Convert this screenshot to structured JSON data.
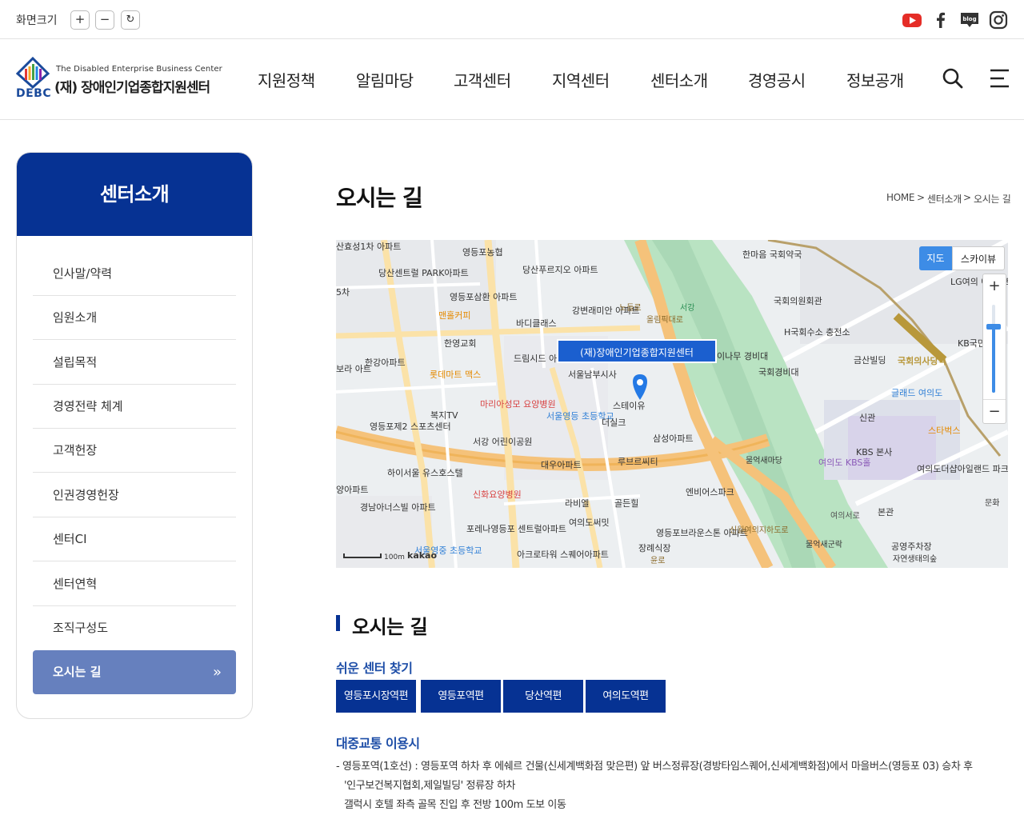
{
  "util": {
    "zoom_label": "화면크기",
    "zoom_in": "+",
    "zoom_out": "−",
    "zoom_reset": "↻",
    "blog_text": "blog"
  },
  "logo": {
    "en": "The Disabled Enterprise Business Center",
    "ko": "(재) 장애인기업종합지원센터",
    "abbr": "DEBC"
  },
  "gnb": [
    "지원정책",
    "알림마당",
    "고객센터",
    "지역센터",
    "센터소개",
    "경영공시",
    "정보공개"
  ],
  "sidebar": {
    "title": "센터소개",
    "items": [
      "인사말/약력",
      "임원소개",
      "설립목적",
      "경영전략 체계",
      "고객헌장",
      "인권경영헌장",
      "센터CI",
      "센터연혁",
      "조직구성도"
    ],
    "active": "오시는 길",
    "active_icon": "»"
  },
  "page": {
    "title": "오시는 길",
    "breadcrumb": [
      "HOME",
      "센터소개",
      "오시는 길"
    ],
    "breadcrumb_sep": ">"
  },
  "map": {
    "type_map": "지도",
    "type_sky": "스카이뷰",
    "zoom_plus": "+",
    "zoom_minus": "−",
    "place_label": "(재)장애인기업종합지원센터",
    "scale": "100m",
    "brand": "kakao",
    "labels": [
      "산효성1차 아파트",
      "영등포농협",
      "당산센트럴 PARK아파트",
      "당산푸르지오 아파트",
      "영등포삼환 아파트",
      "맨홀커피",
      "강변래미안 아파트",
      "바디클래스",
      "한영교회",
      "한강아파트",
      "드림시드 아파트",
      "롯데마트 맥스",
      "서울남부시사",
      "스테이유",
      "마리아성모 요양병원",
      "복지TV",
      "서울영등 초등학교",
      "더실크",
      "영등포제2 스포츠센터",
      "서강 어린이공원",
      "삼성아파트",
      "대우아파트",
      "루브르씨티",
      "하이서울 유스호스텔",
      "신화요양병원",
      "엔비어스파크",
      "경남아너스빌 아파트",
      "라비엘",
      "골든힐",
      "여의도써밋",
      "포레나영등포 센트럴아파트",
      "영등포브라운스톤 아파트",
      "장례식장",
      "서울영중 초등학교",
      "아크로타워 스퀘어아파트",
      "한마음 국회약국",
      "국회의원회관",
      "H국회수소 충전소",
      "LG여의 에클라트오",
      "KB국민",
      "금산빌딩",
      "국회경비대",
      "국회의사당역",
      "글래드 여의도",
      "신관",
      "KBS 본사",
      "스타벅스",
      "여의도 KBS홀",
      "여의도더샵아일랜드 파크오피스텔",
      "본관",
      "물억새마당",
      "물억새군락",
      "공영주차장",
      "자연생태의숲",
      "문화",
      "보라 아트",
      "양아파트",
      "노들로",
      "올림픽대로",
      "여의서로",
      "신월여의지하도로",
      "윤로",
      "서강",
      "이나무 경비대",
      "5차"
    ]
  },
  "section": {
    "title": "오시는 길",
    "easy_find": "쉬운 센터 찾기",
    "stations": [
      "영등포시장역편",
      "영등포역편",
      "당산역편",
      "여의도역편"
    ],
    "transit_title": "대중교통 이용시",
    "transit_lines": [
      "-  영등포역(1호선) : 영등포역 하차 후 에쉐르 건물(신세계백화점 맞은편) 앞 버스정류장(경방타임스퀘어,신세계백화점)에서 마을버스(영등포 03) 승차 후",
      "'인구보건복지협회,제일빌딩' 정류장 하차",
      "갤럭시 호텔 좌측 골목 진입 후 전방 100m 도보 이동"
    ]
  }
}
